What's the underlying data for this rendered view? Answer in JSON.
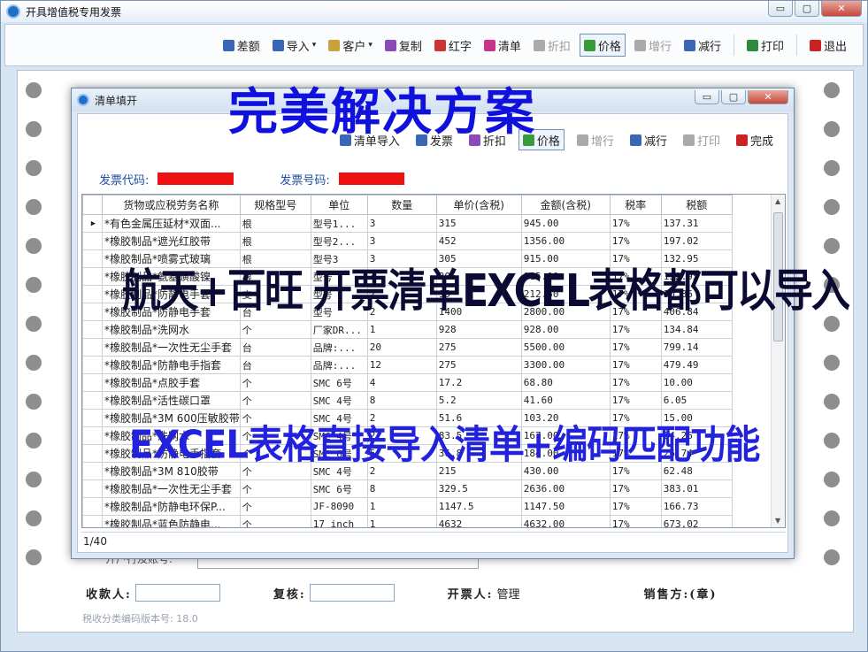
{
  "main_window": {
    "title": "开具增值税专用发票",
    "controls": {
      "minimize": "▭",
      "maximize": "▢",
      "close": "✕"
    }
  },
  "toolbar": {
    "items": [
      {
        "label": "差额",
        "icon": "calculator-icon",
        "color": "#3a66b8",
        "disabled": false
      },
      {
        "label": "导入",
        "icon": "import-icon",
        "color": "#3a66b8",
        "disabled": false,
        "dropdown": true
      },
      {
        "label": "客户",
        "icon": "customer-icon",
        "color": "#c8a23a",
        "disabled": false,
        "dropdown": true
      },
      {
        "label": "复制",
        "icon": "copy-icon",
        "color": "#8a4bb8",
        "disabled": false
      },
      {
        "label": "红字",
        "icon": "red-invoice-icon",
        "color": "#cc3333",
        "disabled": false
      },
      {
        "label": "清单",
        "icon": "list-icon",
        "color": "#cc3388",
        "disabled": false
      },
      {
        "label": "折扣",
        "icon": "discount-icon",
        "color": "#aaaaaa",
        "disabled": true
      },
      {
        "label": "价格",
        "icon": "price-icon",
        "color": "#3a9a3a",
        "disabled": false,
        "pressed": true
      },
      {
        "label": "增行",
        "icon": "add-row-icon",
        "color": "#aaaaaa",
        "disabled": true
      },
      {
        "label": "减行",
        "icon": "remove-row-icon",
        "color": "#3a66b8",
        "disabled": false
      },
      {
        "label": "打印",
        "icon": "print-icon",
        "color": "#2e8a3a",
        "disabled": false
      },
      {
        "label": "退出",
        "icon": "power-icon",
        "color": "#cc2222",
        "disabled": false
      }
    ]
  },
  "form_bottom": {
    "payee_label": "收款人:",
    "reviewer_label": "复核:",
    "issuer_label": "开票人:",
    "issuer_value": "管理",
    "seller_label": "销售方:(章)",
    "version_text": "税收分类编码版本号: 18.0",
    "hidden_field_label": "开户行及账号:"
  },
  "dialog": {
    "title": "清单填开",
    "controls": {
      "minimize": "▭",
      "maximize": "▢",
      "close": "✕"
    },
    "toolbar": [
      {
        "label": "清单导入",
        "icon": "import-icon",
        "disabled": false
      },
      {
        "label": "发票",
        "icon": "invoice-icon",
        "disabled": false
      },
      {
        "label": "折扣",
        "icon": "discount-icon",
        "disabled": false
      },
      {
        "label": "价格",
        "icon": "price-icon",
        "disabled": false,
        "pressed": true
      },
      {
        "label": "增行",
        "icon": "add-row-icon",
        "disabled": true
      },
      {
        "label": "减行",
        "icon": "remove-row-icon",
        "disabled": false
      },
      {
        "label": "打印",
        "icon": "print-icon",
        "disabled": true
      },
      {
        "label": "完成",
        "icon": "power-icon",
        "disabled": false
      }
    ],
    "invoice_code_label": "发票代码:",
    "invoice_number_label": "发票号码:",
    "columns": [
      "货物或应税劳务名称",
      "规格型号",
      "单位",
      "数量",
      "单价(含税)",
      "金额(含税)",
      "税率",
      "税额"
    ],
    "rows": [
      [
        "*有色金属压延材*双面...",
        "根",
        "型号1...",
        "3",
        "315",
        "945.00",
        "17%",
        "137.31"
      ],
      [
        "*橡胶制品*遮光红胶带",
        "根",
        "型号2...",
        "3",
        "452",
        "1356.00",
        "17%",
        "197.02"
      ],
      [
        "*橡胶制品*喷雾式玻璃",
        "根",
        "型号3",
        "3",
        "305",
        "915.00",
        "17%",
        "132.95"
      ],
      [
        "*橡胶制品*氨基磺酸镍",
        "根",
        "型号",
        "3",
        "305",
        "915.00",
        "17%",
        "132.95"
      ],
      [
        "*橡胶制品*防静电手套",
        "支",
        "型号",
        "2",
        "95",
        "212.50",
        "17%",
        "30.86"
      ],
      [
        "*橡胶制品*防静电手套",
        "台",
        "型号",
        "2",
        "1400",
        "2800.00",
        "17%",
        "406.84"
      ],
      [
        "*橡胶制品*洗网水",
        "个",
        "厂家DR...",
        "1",
        "928",
        "928.00",
        "17%",
        "134.84"
      ],
      [
        "*橡胶制品*一次性无尘手套",
        "台",
        "品牌:...",
        "20",
        "275",
        "5500.00",
        "17%",
        "799.14"
      ],
      [
        "*橡胶制品*防静电手指套",
        "台",
        "品牌:...",
        "12",
        "275",
        "3300.00",
        "17%",
        "479.49"
      ],
      [
        "*橡胶制品*点胶手套",
        "个",
        "SMC  6号",
        "4",
        "17.2",
        "68.80",
        "17%",
        "10.00"
      ],
      [
        "*橡胶制品*活性碳口罩",
        "个",
        "SMC  4号",
        "8",
        "5.2",
        "41.60",
        "17%",
        "6.05"
      ],
      [
        "*橡胶制品*3M 600压敏胶带",
        "个",
        "SMC  4号",
        "2",
        "51.6",
        "103.20",
        "17%",
        "15.00"
      ],
      [
        "*橡胶制品*洗网水",
        "个",
        "SMC  4号",
        "2",
        "83.5",
        "167.00",
        "17%",
        "24.26"
      ],
      [
        "*橡胶制品*防静电手指套",
        "个",
        "SMC  6号",
        "5",
        "36.8",
        "184.00",
        "17%",
        "26.74"
      ],
      [
        "*橡胶制品*3M 810胶带",
        "个",
        "SMC  4号",
        "2",
        "215",
        "430.00",
        "17%",
        "62.48"
      ],
      [
        "*橡胶制品*一次性无尘手套",
        "个",
        "SMC  6号",
        "8",
        "329.5",
        "2636.00",
        "17%",
        "383.01"
      ],
      [
        "*橡胶制品*防静电环保P...",
        "个",
        "JF-8090",
        "1",
        "1147.5",
        "1147.50",
        "17%",
        "166.73"
      ],
      [
        "*橡胶制品*蓝色防静电...",
        "个",
        "17 inch",
        "1",
        "4632",
        "4632.00",
        "17%",
        "673.02"
      ]
    ],
    "status": "1/40"
  },
  "watermarks": {
    "headline": "完美解决方案",
    "line2": "航天+百旺 开票清单EXCEL表格都可以导入",
    "line3": "EXCEL表格直接导入清单+编码匹配功能"
  },
  "colors": {
    "accent": "#1f4ea3",
    "redaction": "#ee1111",
    "selected_cell": "#8fb6e0"
  }
}
